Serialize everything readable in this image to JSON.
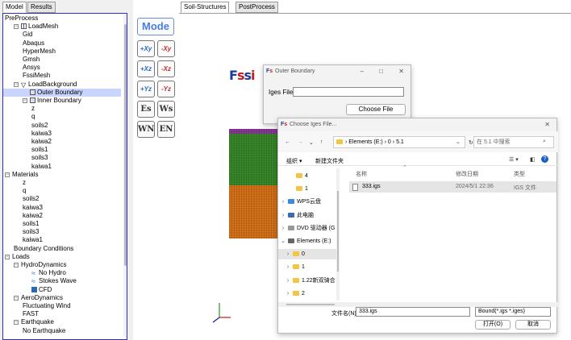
{
  "left_tabs": [
    "Model",
    "Results"
  ],
  "tree": [
    {
      "label": "PreProcess",
      "indent": 0,
      "toggle": "",
      "icon": ""
    },
    {
      "label": "LoadMesh",
      "indent": 1,
      "toggle": "-",
      "icon": "grid-icon"
    },
    {
      "label": "Gid",
      "indent": 2,
      "toggle": "",
      "icon": ""
    },
    {
      "label": "Abaqus",
      "indent": 2,
      "toggle": "",
      "icon": ""
    },
    {
      "label": "HyperMesh",
      "indent": 2,
      "toggle": "",
      "icon": ""
    },
    {
      "label": "Gmsh",
      "indent": 2,
      "toggle": "",
      "icon": ""
    },
    {
      "label": "Ansys",
      "indent": 2,
      "toggle": "",
      "icon": ""
    },
    {
      "label": "FssiMesh",
      "indent": 2,
      "toggle": "",
      "icon": ""
    },
    {
      "label": "LoadBackground",
      "indent": 1,
      "toggle": "-",
      "icon": "funnel-icon"
    },
    {
      "label": "Outer Boundary",
      "indent": 2,
      "toggle": "",
      "icon": "boundary-icon",
      "selected": true
    },
    {
      "label": "Inner Boundary",
      "indent": 2,
      "toggle": "-",
      "icon": "boundary-icon"
    },
    {
      "label": "z",
      "indent": 3,
      "toggle": "",
      "icon": ""
    },
    {
      "label": "q",
      "indent": 3,
      "toggle": "",
      "icon": ""
    },
    {
      "label": "soils2",
      "indent": 3,
      "toggle": "",
      "icon": ""
    },
    {
      "label": "kaiwa3",
      "indent": 3,
      "toggle": "",
      "icon": ""
    },
    {
      "label": "kaiwa2",
      "indent": 3,
      "toggle": "",
      "icon": ""
    },
    {
      "label": "soils1",
      "indent": 3,
      "toggle": "",
      "icon": ""
    },
    {
      "label": "soils3",
      "indent": 3,
      "toggle": "",
      "icon": ""
    },
    {
      "label": "kaiwa1",
      "indent": 3,
      "toggle": "",
      "icon": ""
    },
    {
      "label": "Materials",
      "indent": 0,
      "toggle": "-",
      "icon": ""
    },
    {
      "label": "z",
      "indent": 2,
      "toggle": "",
      "icon": ""
    },
    {
      "label": "q",
      "indent": 2,
      "toggle": "",
      "icon": ""
    },
    {
      "label": "soils2",
      "indent": 2,
      "toggle": "",
      "icon": ""
    },
    {
      "label": "kaiwa3",
      "indent": 2,
      "toggle": "",
      "icon": ""
    },
    {
      "label": "kaiwa2",
      "indent": 2,
      "toggle": "",
      "icon": ""
    },
    {
      "label": "soils1",
      "indent": 2,
      "toggle": "",
      "icon": ""
    },
    {
      "label": "soils3",
      "indent": 2,
      "toggle": "",
      "icon": ""
    },
    {
      "label": "kaiwa1",
      "indent": 2,
      "toggle": "",
      "icon": ""
    },
    {
      "label": "Boundary Conditions",
      "indent": 1,
      "toggle": "",
      "icon": ""
    },
    {
      "label": "Loads",
      "indent": 0,
      "toggle": "-",
      "icon": ""
    },
    {
      "label": "HydroDynamics",
      "indent": 1,
      "toggle": "-",
      "icon": ""
    },
    {
      "label": "No Hydro",
      "indent": 3,
      "toggle": "",
      "icon": "wave-icon"
    },
    {
      "label": "Stokes Wave",
      "indent": 3,
      "toggle": "",
      "icon": "wave-icon"
    },
    {
      "label": "CFD",
      "indent": 3,
      "toggle": "",
      "icon": "cfd-icon"
    },
    {
      "label": "AeroDynamics",
      "indent": 1,
      "toggle": "-",
      "icon": ""
    },
    {
      "label": "Fluctuating Wind",
      "indent": 2,
      "toggle": "",
      "icon": ""
    },
    {
      "label": "FAST",
      "indent": 2,
      "toggle": "",
      "icon": ""
    },
    {
      "label": "Earthquake",
      "indent": 1,
      "toggle": "-",
      "icon": ""
    },
    {
      "label": "No Earthquake",
      "indent": 2,
      "toggle": "",
      "icon": ""
    }
  ],
  "toolbar": {
    "mode": "Mode",
    "buttons": [
      "+Xy",
      "-Xy",
      "+Xz",
      "-Xz",
      "+Yz",
      "-Yz",
      "Es",
      "Ws",
      "WN",
      "EN"
    ]
  },
  "main_tabs": [
    "Soil-Structures",
    "PostProcess"
  ],
  "logo": "Fssi",
  "outer_dialog": {
    "title": "Outer Boundary",
    "iges_label": "Iges File",
    "iges_value": "",
    "choose_button": "Choose File"
  },
  "file_dialog": {
    "title": "Choose Iges File...",
    "breadcrumb": [
      "Elements (E:)",
      "0",
      "5.1"
    ],
    "search_placeholder": "在 5.1 中搜索",
    "organize": "组织 ▾",
    "new_folder": "新建文件夹",
    "nav_items": [
      {
        "label": "4",
        "type": "folder"
      },
      {
        "label": "1",
        "type": "folder"
      },
      {
        "label": "WPS云盘",
        "type": "cloud"
      },
      {
        "label": "此电脑",
        "type": "pc"
      },
      {
        "label": "DVD 驱动器 (G",
        "type": "dvd"
      },
      {
        "label": "Elements (E:)",
        "type": "drive"
      },
      {
        "label": "0",
        "type": "folder",
        "selected": true
      },
      {
        "label": "1",
        "type": "folder"
      },
      {
        "label": "1.22新双骑合",
        "type": "folder"
      },
      {
        "label": "2",
        "type": "folder"
      }
    ],
    "columns": [
      "名称",
      "修改日期",
      "类型"
    ],
    "files": [
      {
        "name": "333.igs",
        "date": "2024/5/1 22:36",
        "type": "IGS 文件"
      }
    ],
    "filename_label": "文件名(N):",
    "filename_value": "333.igs",
    "filter": "Bound(*.igs *.iges)",
    "open_button": "打开(O)",
    "cancel_button": "取消"
  }
}
